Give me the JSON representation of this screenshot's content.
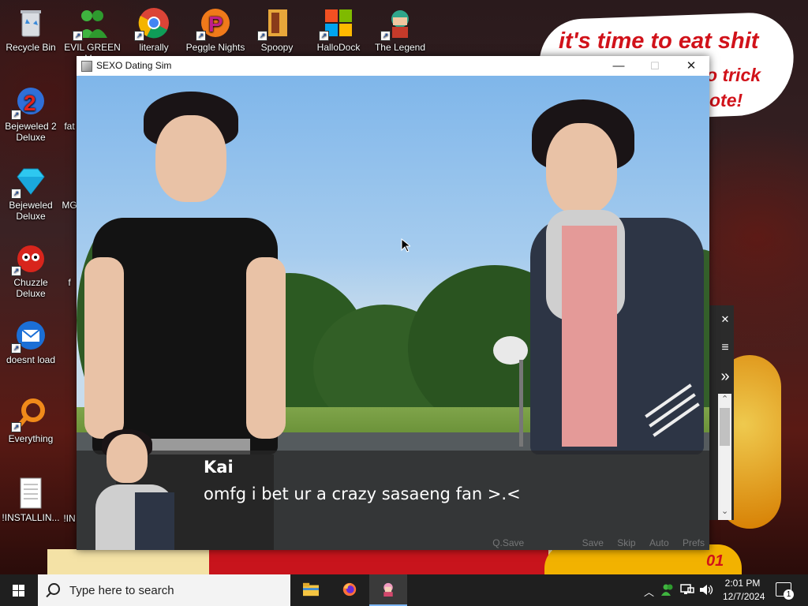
{
  "desktop": {
    "icons": [
      {
        "label": "Recycle Bin",
        "icon": "recycle-bin-icon"
      },
      {
        "label": "EVIL GREEN M...",
        "icon": "people-icon"
      },
      {
        "label": "literally",
        "icon": "chrome-icon"
      },
      {
        "label": "Peggle Nights",
        "icon": "peggle-icon"
      },
      {
        "label": "Spoopy",
        "icon": "spoopy-icon"
      },
      {
        "label": "HalloDock",
        "icon": "windows-logo-icon"
      },
      {
        "label": "The Legend",
        "icon": "game-character-icon"
      },
      {
        "label": "Bejeweled 2 Deluxe",
        "icon": "bejeweled-2-icon"
      },
      {
        "label": "fat",
        "icon": "app-icon"
      },
      {
        "label": "Bejeweled Deluxe",
        "icon": "diamond-icon"
      },
      {
        "label": "MG",
        "icon": "app-icon"
      },
      {
        "label": "Chuzzle Deluxe",
        "icon": "chuzzle-icon"
      },
      {
        "label": "f",
        "icon": "app-icon"
      },
      {
        "label": "doesnt load",
        "icon": "thunderbird-icon"
      },
      {
        "label": "Everything",
        "icon": "search-ring-icon"
      },
      {
        "label": "!INSTALLIN...",
        "icon": "text-file-icon"
      },
      {
        "label": "!IN",
        "icon": "text-file-icon"
      }
    ],
    "wallpaper_bubble": {
      "line1": "it's time to eat shit",
      "line2": "o trick",
      "line3": "ote!"
    },
    "wallpaper_bottom_text": "01"
  },
  "window": {
    "title": "SEXO Dating Sim",
    "minimize": "—",
    "maximize": "☐",
    "close": "✕"
  },
  "game": {
    "speaker": "Kai",
    "dialogue": "omfg i bet ur a crazy sasaeng fan >.<",
    "quick_menu": [
      "Q.Save",
      "Save",
      "Skip",
      "Auto",
      "Prefs"
    ]
  },
  "side_widget": {
    "close": "✕",
    "menu": "≡",
    "forward": "»",
    "scroll_up": "⌃",
    "scroll_down": "⌄"
  },
  "taskbar": {
    "search_placeholder": "Type here to search",
    "apps": [
      "file-explorer-icon",
      "firefox-icon",
      "dating-sim-icon"
    ],
    "time": "2:01 PM",
    "date": "12/7/2024",
    "notification_count": "1"
  },
  "colors": {
    "bubble_text": "#d1121a",
    "taskbar": "#1f1f1f",
    "active_indicator": "#7cb6f5"
  }
}
